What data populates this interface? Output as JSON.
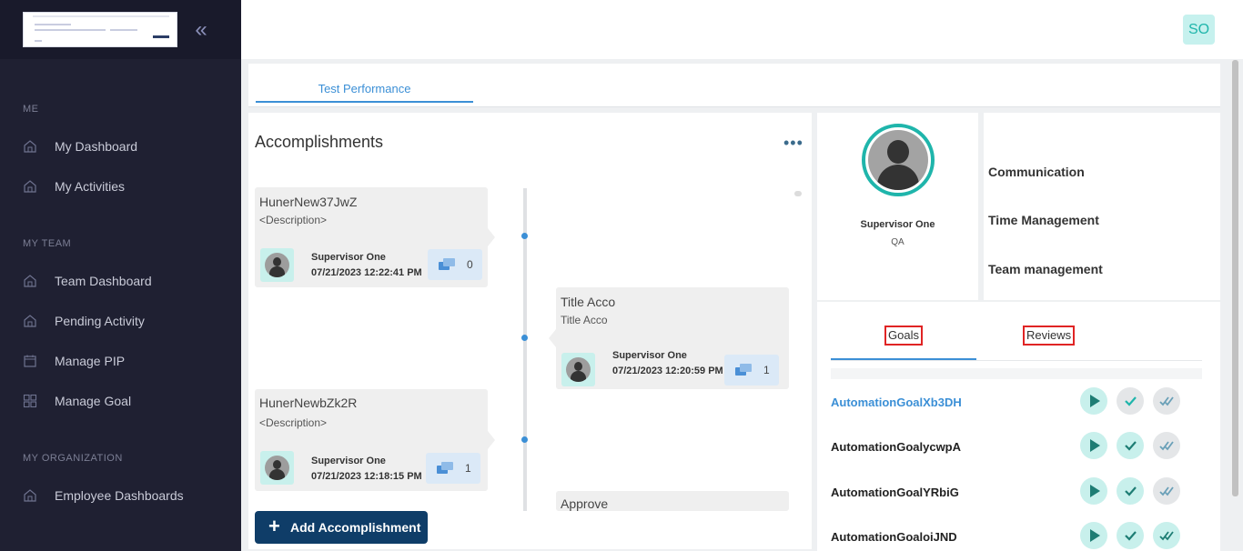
{
  "sidebar": {
    "sections": [
      {
        "label": "ME",
        "items": [
          {
            "label": "My Dashboard",
            "icon": "home-icon"
          },
          {
            "label": "My Activities",
            "icon": "home-icon"
          }
        ]
      },
      {
        "label": "MY TEAM",
        "items": [
          {
            "label": "Team Dashboard",
            "icon": "home-icon"
          },
          {
            "label": "Pending Activity",
            "icon": "home-icon"
          },
          {
            "label": "Manage PIP",
            "icon": "calendar-icon"
          },
          {
            "label": "Manage Goal",
            "icon": "grid-icon"
          }
        ]
      },
      {
        "label": "MY ORGANIZATION",
        "items": [
          {
            "label": "Employee Dashboards",
            "icon": "home-icon"
          }
        ]
      }
    ],
    "collapse_glyph": "«"
  },
  "header": {
    "user_initials": "SO",
    "accent": "#1fb5ab"
  },
  "tabs": {
    "active": "Test Performance"
  },
  "accomplishments": {
    "title": "Accomplishments",
    "more_glyph": "•••",
    "add_button": "Add Accomplishment",
    "cards": [
      {
        "title": "HunerNew37JwZ",
        "description": "<Description>",
        "author": "Supervisor One",
        "date": "07/21/2023 12:22:41 PM",
        "comments": "0"
      },
      {
        "title": "Title Acco",
        "description": "Title Acco",
        "author": "Supervisor One",
        "date": "07/21/2023 12:20:59 PM",
        "comments": "1"
      },
      {
        "title": "HunerNewbZk2R",
        "description": "<Description>",
        "author": "Supervisor One",
        "date": "07/21/2023 12:18:15 PM",
        "comments": "1"
      },
      {
        "title": "Approve"
      }
    ]
  },
  "profile": {
    "name": "Supervisor One",
    "role": "QA"
  },
  "competencies": [
    "Communication",
    "Time Management",
    "Team management"
  ],
  "goals": {
    "tabs": [
      "Goals",
      "Reviews"
    ],
    "items": [
      "AutomationGoalXb3DH",
      "AutomationGoalycwpA",
      "AutomationGoalYRbiG",
      "AutomationGoaloiJND"
    ]
  }
}
